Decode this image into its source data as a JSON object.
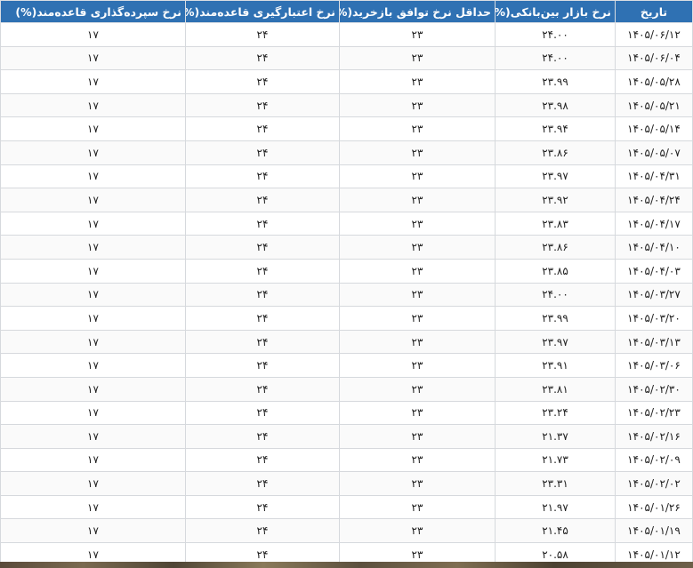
{
  "table": {
    "headers": [
      "تاریخ",
      "نرخ بازار بین‌بانکی(%)",
      "حداقل نرخ توافق بازخرید(%)",
      "نرخ اعتبارگیری قاعده‌مند(%)",
      "نرخ سپرده‌گذاری قاعده‌مند(%)"
    ],
    "rows": [
      [
        "۱۴۰۵/۰۶/۱۲",
        "۲۴.۰۰",
        "۲۳",
        "۲۴",
        "۱۷"
      ],
      [
        "۱۴۰۵/۰۶/۰۴",
        "۲۴.۰۰",
        "۲۳",
        "۲۴",
        "۱۷"
      ],
      [
        "۱۴۰۵/۰۵/۲۸",
        "۲۳.۹۹",
        "۲۳",
        "۲۴",
        "۱۷"
      ],
      [
        "۱۴۰۵/۰۵/۲۱",
        "۲۳.۹۸",
        "۲۳",
        "۲۴",
        "۱۷"
      ],
      [
        "۱۴۰۵/۰۵/۱۴",
        "۲۳.۹۴",
        "۲۳",
        "۲۴",
        "۱۷"
      ],
      [
        "۱۴۰۵/۰۵/۰۷",
        "۲۳.۸۶",
        "۲۳",
        "۲۴",
        "۱۷"
      ],
      [
        "۱۴۰۵/۰۴/۳۱",
        "۲۳.۹۷",
        "۲۳",
        "۲۴",
        "۱۷"
      ],
      [
        "۱۴۰۵/۰۴/۲۴",
        "۲۳.۹۲",
        "۲۳",
        "۲۴",
        "۱۷"
      ],
      [
        "۱۴۰۵/۰۴/۱۷",
        "۲۳.۸۳",
        "۲۳",
        "۲۴",
        "۱۷"
      ],
      [
        "۱۴۰۵/۰۴/۱۰",
        "۲۳.۸۶",
        "۲۳",
        "۲۴",
        "۱۷"
      ],
      [
        "۱۴۰۵/۰۴/۰۳",
        "۲۳.۸۵",
        "۲۳",
        "۲۴",
        "۱۷"
      ],
      [
        "۱۴۰۵/۰۳/۲۷",
        "۲۴.۰۰",
        "۲۳",
        "۲۴",
        "۱۷"
      ],
      [
        "۱۴۰۵/۰۳/۲۰",
        "۲۳.۹۹",
        "۲۳",
        "۲۴",
        "۱۷"
      ],
      [
        "۱۴۰۵/۰۳/۱۳",
        "۲۳.۹۷",
        "۲۳",
        "۲۴",
        "۱۷"
      ],
      [
        "۱۴۰۵/۰۳/۰۶",
        "۲۳.۹۱",
        "۲۳",
        "۲۴",
        "۱۷"
      ],
      [
        "۱۴۰۵/۰۲/۳۰",
        "۲۳.۸۱",
        "۲۳",
        "۲۴",
        "۱۷"
      ],
      [
        "۱۴۰۵/۰۲/۲۳",
        "۲۳.۲۴",
        "۲۳",
        "۲۴",
        "۱۷"
      ],
      [
        "۱۴۰۵/۰۲/۱۶",
        "۲۱.۳۷",
        "۲۳",
        "۲۴",
        "۱۷"
      ],
      [
        "۱۴۰۵/۰۲/۰۹",
        "۲۱.۷۳",
        "۲۳",
        "۲۴",
        "۱۷"
      ],
      [
        "۱۴۰۵/۰۲/۰۲",
        "۲۳.۳۱",
        "۲۳",
        "۲۴",
        "۱۷"
      ],
      [
        "۱۴۰۵/۰۱/۲۶",
        "۲۱.۹۷",
        "۲۳",
        "۲۴",
        "۱۷"
      ],
      [
        "۱۴۰۵/۰۱/۱۹",
        "۲۱.۴۵",
        "۲۳",
        "۲۴",
        "۱۷"
      ],
      [
        "۱۴۰۵/۰۱/۱۲",
        "۲۰.۵۸",
        "۲۳",
        "۲۴",
        "۱۷"
      ]
    ]
  },
  "colors": {
    "header_background": "#2f71b3",
    "header_text": "#ffffff",
    "cell_border": "#d6d9dd"
  }
}
